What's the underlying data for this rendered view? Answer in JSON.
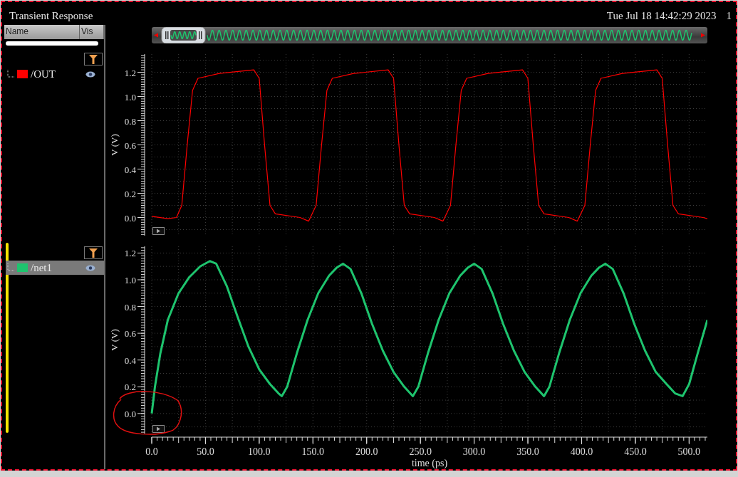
{
  "window": {
    "title": "Transient Response",
    "timestamp": "Tue Jul 18 14:42:29 2023",
    "page_number": "1"
  },
  "signal_list": {
    "columns": [
      "Name",
      "Vis"
    ]
  },
  "strips": [
    {
      "active": false,
      "signals": [
        {
          "name": "/OUT",
          "color": "#ff0000",
          "selected": false,
          "visible": true
        }
      ],
      "chart_data": {
        "type": "line",
        "grid": true,
        "ylabel": "V (V)",
        "xlim": [
          0,
          517
        ],
        "ylim": [
          -0.15,
          1.35
        ],
        "yticks": [
          {
            "value": 0,
            "label": "0.0"
          },
          {
            "value": 0.2,
            "label": "0.2"
          },
          {
            "value": 0.4,
            "label": "0.4"
          },
          {
            "value": 0.6,
            "label": "0.6"
          },
          {
            "value": 0.8,
            "label": "0.8"
          },
          {
            "value": 1.0,
            "label": "1.0"
          },
          {
            "value": 1.2,
            "label": "1.2"
          }
        ],
        "x": [
          0,
          15,
          23,
          28,
          33,
          38,
          43,
          63,
          95,
          100,
          105,
          110,
          115,
          138,
          146,
          153,
          158,
          163,
          168,
          188,
          220,
          225,
          230,
          235,
          240,
          263,
          271,
          278,
          283,
          288,
          293,
          313,
          345,
          350,
          355,
          360,
          365,
          388,
          396,
          403,
          408,
          413,
          418,
          438,
          470,
          475,
          480,
          485,
          490,
          513,
          517
        ],
        "series": [
          {
            "color": "#ff0000",
            "values": [
              0.01,
              -0.01,
              0.0,
              0.1,
              0.6,
              1.05,
              1.15,
              1.19,
              1.22,
              1.15,
              0.6,
              0.1,
              0.03,
              0.0,
              -0.03,
              0.1,
              0.6,
              1.05,
              1.15,
              1.19,
              1.22,
              1.15,
              0.6,
              0.1,
              0.03,
              0.0,
              -0.03,
              0.1,
              0.6,
              1.05,
              1.15,
              1.19,
              1.22,
              1.15,
              0.6,
              0.1,
              0.03,
              0.0,
              -0.03,
              0.1,
              0.6,
              1.05,
              1.15,
              1.19,
              1.22,
              1.15,
              0.6,
              0.1,
              0.03,
              0.0,
              -0.01
            ]
          }
        ]
      }
    },
    {
      "active": true,
      "signals": [
        {
          "name": "/net1",
          "color": "#1ec46e",
          "selected": true,
          "visible": true
        }
      ],
      "chart_data": {
        "type": "line",
        "grid": true,
        "xlabel": "time (ps)",
        "ylabel": "V (V)",
        "xlim": [
          0,
          517
        ],
        "ylim": [
          -0.15,
          1.25
        ],
        "xticks": [
          {
            "value": 0,
            "label": "0.0"
          },
          {
            "value": 50,
            "label": "50.0"
          },
          {
            "value": 100,
            "label": "100.0"
          },
          {
            "value": 150,
            "label": "150.0"
          },
          {
            "value": 200,
            "label": "200.0"
          },
          {
            "value": 250,
            "label": "250.0"
          },
          {
            "value": 300,
            "label": "300.0"
          },
          {
            "value": 350,
            "label": "350.0"
          },
          {
            "value": 400,
            "label": "400.0"
          },
          {
            "value": 450,
            "label": "450.0"
          },
          {
            "value": 500,
            "label": "500.0"
          }
        ],
        "yticks": [
          {
            "value": 0,
            "label": "0.0"
          },
          {
            "value": 0.2,
            "label": "0.2"
          },
          {
            "value": 0.4,
            "label": "0.4"
          },
          {
            "value": 0.6,
            "label": "0.6"
          },
          {
            "value": 0.8,
            "label": "0.8"
          },
          {
            "value": 1.0,
            "label": "1.0"
          },
          {
            "value": 1.2,
            "label": "1.2"
          }
        ],
        "x": [
          0,
          3,
          8,
          15,
          25,
          35,
          45,
          54,
          60,
          70,
          80,
          90,
          100,
          110,
          118,
          121,
          126,
          135,
          145,
          155,
          165,
          172,
          178,
          185,
          195,
          205,
          215,
          225,
          235,
          243,
          248,
          257,
          267,
          277,
          287,
          294,
          300,
          307,
          317,
          327,
          337,
          347,
          357,
          365,
          370,
          379,
          389,
          399,
          409,
          416,
          422,
          429,
          439,
          449,
          459,
          469,
          479,
          487,
          494,
          500,
          508,
          517
        ],
        "series": [
          {
            "color": "#1ec46e",
            "values": [
              0.0,
              0.2,
              0.45,
              0.7,
              0.9,
              1.02,
              1.1,
              1.14,
              1.12,
              0.95,
              0.72,
              0.5,
              0.33,
              0.22,
              0.15,
              0.13,
              0.2,
              0.45,
              0.7,
              0.9,
              1.03,
              1.09,
              1.12,
              1.08,
              0.9,
              0.67,
              0.47,
              0.31,
              0.2,
              0.13,
              0.2,
              0.45,
              0.7,
              0.9,
              1.03,
              1.09,
              1.12,
              1.08,
              0.9,
              0.67,
              0.47,
              0.31,
              0.2,
              0.13,
              0.2,
              0.45,
              0.7,
              0.9,
              1.03,
              1.09,
              1.12,
              1.08,
              0.9,
              0.67,
              0.47,
              0.31,
              0.22,
              0.15,
              0.13,
              0.22,
              0.45,
              0.7
            ]
          }
        ]
      }
    }
  ]
}
